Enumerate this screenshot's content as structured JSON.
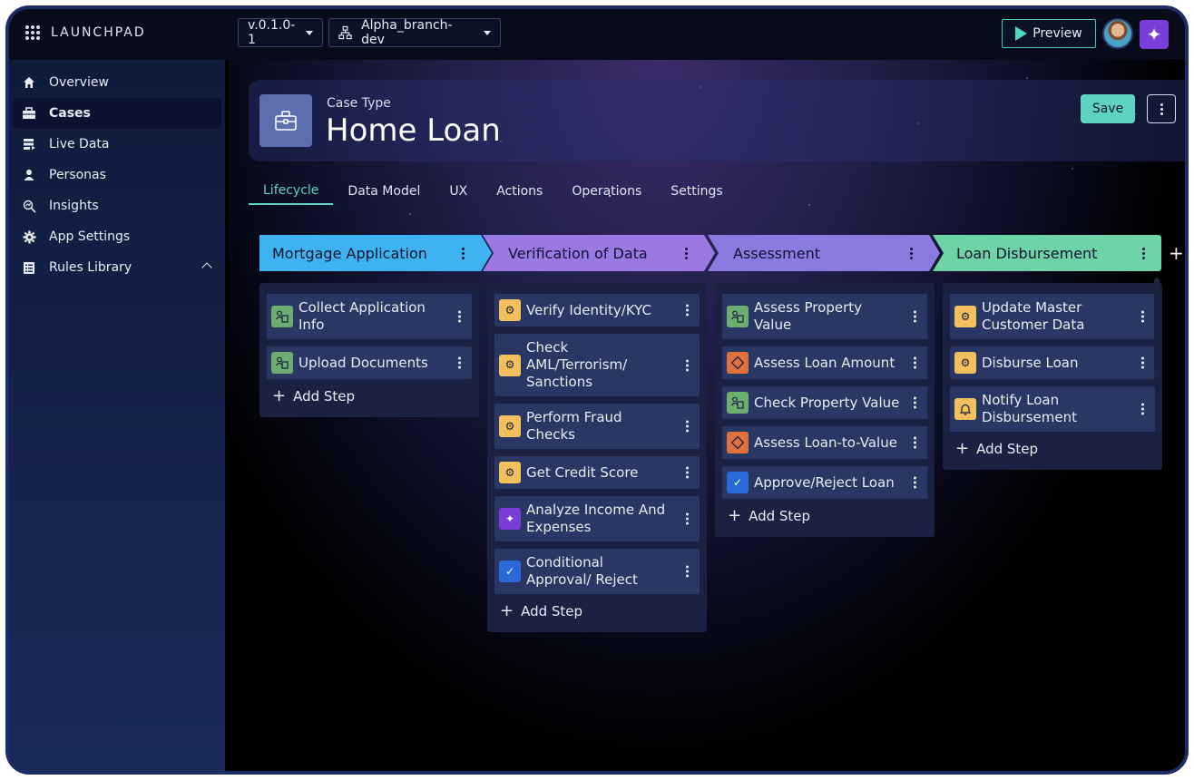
{
  "app": {
    "brand": "LAUNCHPAD"
  },
  "topbar": {
    "version": "v.0.1.0-1",
    "branch": "Alpha_branch-dev",
    "preview_label": "Preview"
  },
  "sidebar": {
    "items": [
      {
        "label": "Overview",
        "icon": "home-icon"
      },
      {
        "label": "Cases",
        "icon": "briefcase-icon"
      },
      {
        "label": "Live Data",
        "icon": "data-icon"
      },
      {
        "label": "Personas",
        "icon": "personas-icon"
      },
      {
        "label": "Insights",
        "icon": "insights-icon"
      },
      {
        "label": "App Settings",
        "icon": "gear-icon"
      },
      {
        "label": "Rules Library",
        "icon": "rules-icon"
      }
    ]
  },
  "header": {
    "eyebrow": "Case Type",
    "title": "Home Loan",
    "save_label": "Save"
  },
  "tabs": [
    "Lifecycle",
    "Data Model",
    "UX",
    "Actions",
    "Operations",
    "Settings"
  ],
  "stages": [
    {
      "name": "Mortgage Application",
      "color": "#3fb3f2",
      "steps": [
        {
          "label": "Collect Application Info",
          "icon": "form-icon",
          "color": "#6cae70"
        },
        {
          "label": "Upload Documents",
          "icon": "form-icon",
          "color": "#6cae70"
        }
      ],
      "add_label": "Add Step"
    },
    {
      "name": "Verification of Data",
      "color": "#9b79e3",
      "steps": [
        {
          "label": "Verify Identity/KYC",
          "icon": "automation-icon",
          "color": "#f2c15e"
        },
        {
          "label": "Check AML/Terrorism/ Sanctions",
          "icon": "automation-icon",
          "color": "#f2c15e"
        },
        {
          "label": "Perform Fraud Checks",
          "icon": "automation-icon",
          "color": "#f2c15e"
        },
        {
          "label": "Get Credit Score",
          "icon": "automation-icon",
          "color": "#f2c15e"
        },
        {
          "label": "Analyze Income And Expenses",
          "icon": "ai-sparkle-icon",
          "color": "#7a3ed8"
        },
        {
          "label": "Conditional Approval/ Reject",
          "icon": "approval-check-icon",
          "color": "#2a6ad8"
        }
      ],
      "add_label": "Add Step"
    },
    {
      "name": "Assessment",
      "color": "#8b7be0",
      "steps": [
        {
          "label": "Assess Property Value",
          "icon": "form-icon",
          "color": "#6cae70"
        },
        {
          "label": "Assess Loan Amount",
          "icon": "decision-diamond-icon",
          "color": "#e2713e"
        },
        {
          "label": "Check Property Value",
          "icon": "form-icon",
          "color": "#6cae70"
        },
        {
          "label": "Assess Loan-to-Value",
          "icon": "decision-diamond-icon",
          "color": "#e2713e"
        },
        {
          "label": "Approve/Reject Loan",
          "icon": "approval-check-icon",
          "color": "#2a6ad8"
        }
      ],
      "add_label": "Add Step"
    },
    {
      "name": "Loan Disbursement",
      "color": "#6ed3a6",
      "steps": [
        {
          "label": "Update Master Customer Data",
          "icon": "automation-icon",
          "color": "#f2c15e"
        },
        {
          "label": "Disburse Loan",
          "icon": "automation-icon",
          "color": "#f2c15e"
        },
        {
          "label": "Notify Loan Disbursement",
          "icon": "bell-icon",
          "color": "#f2c15e"
        }
      ],
      "add_label": "Add Step"
    }
  ]
}
